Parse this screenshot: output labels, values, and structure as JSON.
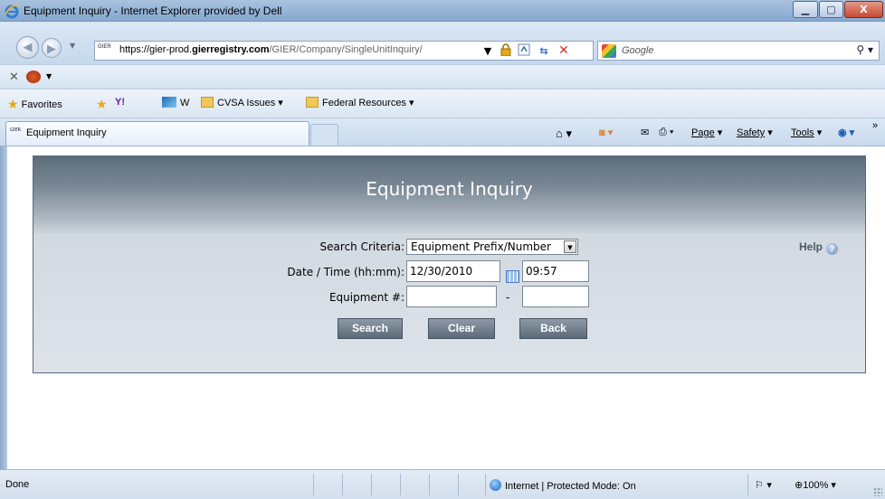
{
  "window": {
    "title": "Equipment Inquiry - Internet Explorer provided by Dell",
    "min_glyph": "▁",
    "max_glyph": "▢",
    "close_glyph": "X"
  },
  "address": {
    "url_prefix": "https://gier-prod.",
    "url_domain": "gierregistry.com",
    "url_path": "/GIER/Company/SingleUnitInquiry/",
    "site_icon_text": "GIER",
    "search_placeholder": "Google"
  },
  "favorites_bar": {
    "favorites": "Favorites",
    "yahoo": "Y!",
    "w": "W",
    "cvsa": "CVSA Issues",
    "federal": "Federal Resources"
  },
  "tab": {
    "icon_text": "GIER",
    "label": "Equipment Inquiry"
  },
  "commands": {
    "page": "Page",
    "safety": "Safety",
    "tools": "Tools",
    "more": "»"
  },
  "panel": {
    "heading": "Equipment Inquiry",
    "help": "Help",
    "search_criteria_label": "Search Criteria:",
    "search_criteria_value": "Equipment Prefix/Number",
    "datetime_label": "Date / Time (hh:mm):",
    "date_value": "12/30/2010",
    "time_value": "09:57",
    "equipment_label": "Equipment #:",
    "dash": "-",
    "search_btn": "Search",
    "clear_btn": "Clear",
    "back_btn": "Back"
  },
  "status": {
    "done": "Done",
    "zone": "Internet | Protected Mode: On",
    "zoom": "100%"
  }
}
